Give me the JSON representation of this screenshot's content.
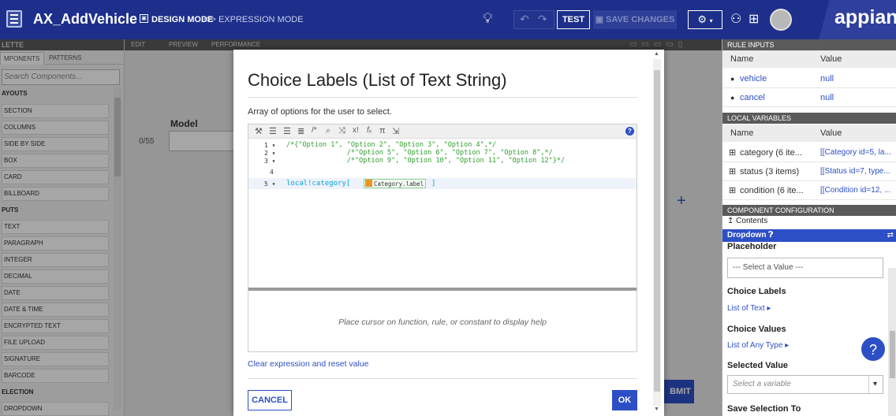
{
  "header": {
    "app_title": "AX_AddVehicle",
    "design_mode": "DESIGN MODE",
    "expression_mode": "</> EXPRESSION MODE",
    "test": "TEST",
    "save_changes": "SAVE CHANGES",
    "brand": "appian"
  },
  "palette": {
    "header": "LETTE",
    "tab_components": "MPONENTS",
    "tab_patterns": "PATTERNS",
    "search_placeholder": "Search Components...",
    "groups": [
      "AYOUTS",
      "PUTS",
      "ELECTION"
    ],
    "items": [
      "SECTION",
      "COLUMNS",
      "SIDE BY SIDE",
      "BOX",
      "CARD",
      "BILLBOARD",
      "TEXT",
      "PARAGRAPH",
      "INTEGER",
      "DECIMAL",
      "DATE",
      "DATE & TIME",
      "ENCRYPTED TEXT",
      "FILE UPLOAD",
      "SIGNATURE",
      "BARCODE",
      "DROPDOWN"
    ]
  },
  "canvas": {
    "edit": "EDIT",
    "preview": "PREVIEW",
    "performance": "PERFORMANCE",
    "model_label": "Model",
    "char_count": "0/55",
    "submit_fragment": "BMIT"
  },
  "right_panel": {
    "rule_inputs_header": "RULE INPUTS",
    "col_name": "Name",
    "col_value": "Value",
    "rule_inputs": [
      {
        "name": "vehicle",
        "value": "null"
      },
      {
        "name": "cancel",
        "value": "null"
      }
    ],
    "local_vars_header": "LOCAL VARIABLES",
    "local_vars": [
      {
        "name": "category (6 ite...",
        "value": "[[Category id=5, la..."
      },
      {
        "name": "status (3 items)",
        "value": "[[Status id=7, type..."
      },
      {
        "name": "condition (6 ite...",
        "value": "[[Condition id=12, ..."
      }
    ],
    "component_config_header": "COMPONENT CONFIGURATION",
    "contents": "Contents",
    "component_name": "Dropdown",
    "placeholder_label": "Placeholder",
    "placeholder_value": "--- Select a Value ---",
    "choice_labels_label": "Choice Labels",
    "choice_labels_link": "List of Text",
    "choice_values_label": "Choice Values",
    "choice_values_link": "List of Any Type",
    "selected_value_label": "Selected Value",
    "selected_value_placeholder": "Select a variable",
    "save_selection_label": "Save Selection To"
  },
  "modal": {
    "title": "Choice Labels (List of Text String)",
    "description": "Array of options for the user to select.",
    "code_lines": [
      "/*{\"Option 1\", \"Option 2\", \"Option 3\", \"Option 4\",*/",
      "               /*\"Option 5\", \"Option 6\", \"Option 7\", \"Option 8\",*/",
      "               /*\"Option 9\", \"Option 10\", \"Option 11\", \"Option 12\"}*/",
      "",
      "local!category["
    ],
    "line_numbers": [
      "1 ▾",
      "2 ▾",
      "3 ▾",
      "4",
      "5 ▾"
    ],
    "code_token": "Category.label",
    "help_text": "Place cursor on function, rule, or constant to display help",
    "clear_link": "Clear expression and reset value",
    "cancel": "CANCEL",
    "ok": "OK"
  }
}
